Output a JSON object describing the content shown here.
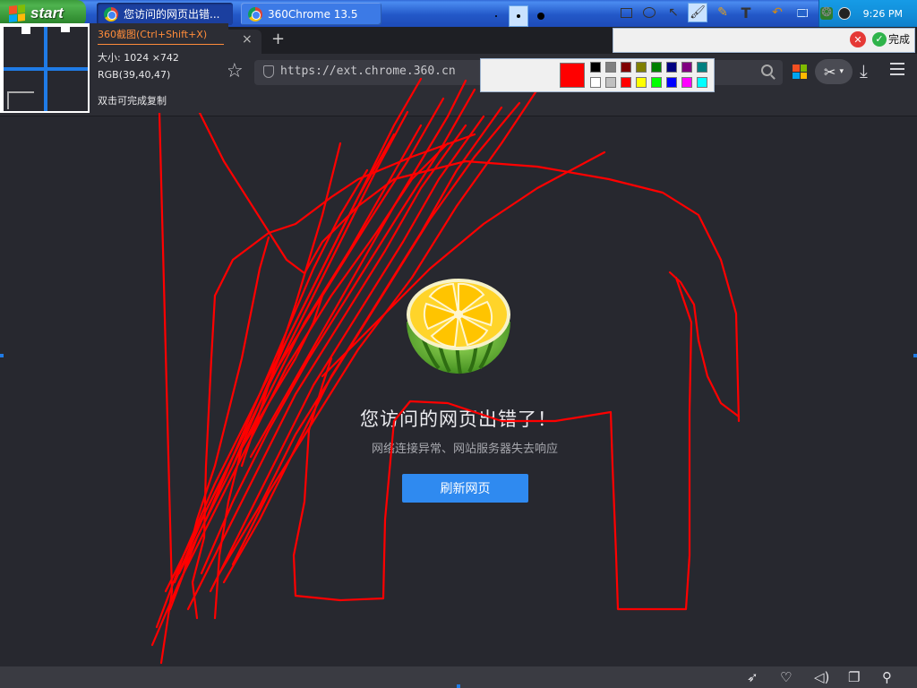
{
  "taskbar": {
    "start_label": "start",
    "tasks": [
      {
        "label": "您访问的网页出错..."
      },
      {
        "label": "360Chrome 13.5"
      }
    ],
    "clock": "9:26 PM"
  },
  "browser": {
    "url": "https://ext.chrome.360.cn"
  },
  "error_page": {
    "title": "您访问的网页出错了！",
    "subtitle": "网络连接异常、网站服务器失去响应",
    "refresh_label": "刷新网页"
  },
  "screenshot_tool": {
    "title": "360截图(Ctrl+Shift+X)",
    "size_text": "大小: 1024 ×742",
    "rgb_text": "RGB(39,40,47)",
    "hint_text": "双击可完成复制",
    "done_label": "完成",
    "tools": [
      "rectangle-icon",
      "ellipse-icon",
      "arrow-icon",
      "brush-icon",
      "highlighter-icon",
      "text-icon",
      "undo-icon",
      "save-icon",
      "mosaic-icon"
    ],
    "active_tool": "brush-icon",
    "current_color": "#ff0000",
    "palette_top": [
      "#000000",
      "#808080",
      "#800000",
      "#808000",
      "#008000",
      "#000080",
      "#800080",
      "#008080"
    ],
    "palette_bottom": [
      "#ffffff",
      "#c0c0c0",
      "#ff0000",
      "#ffff00",
      "#00ff00",
      "#0000ff",
      "#ff00ff",
      "#00ffff"
    ]
  }
}
